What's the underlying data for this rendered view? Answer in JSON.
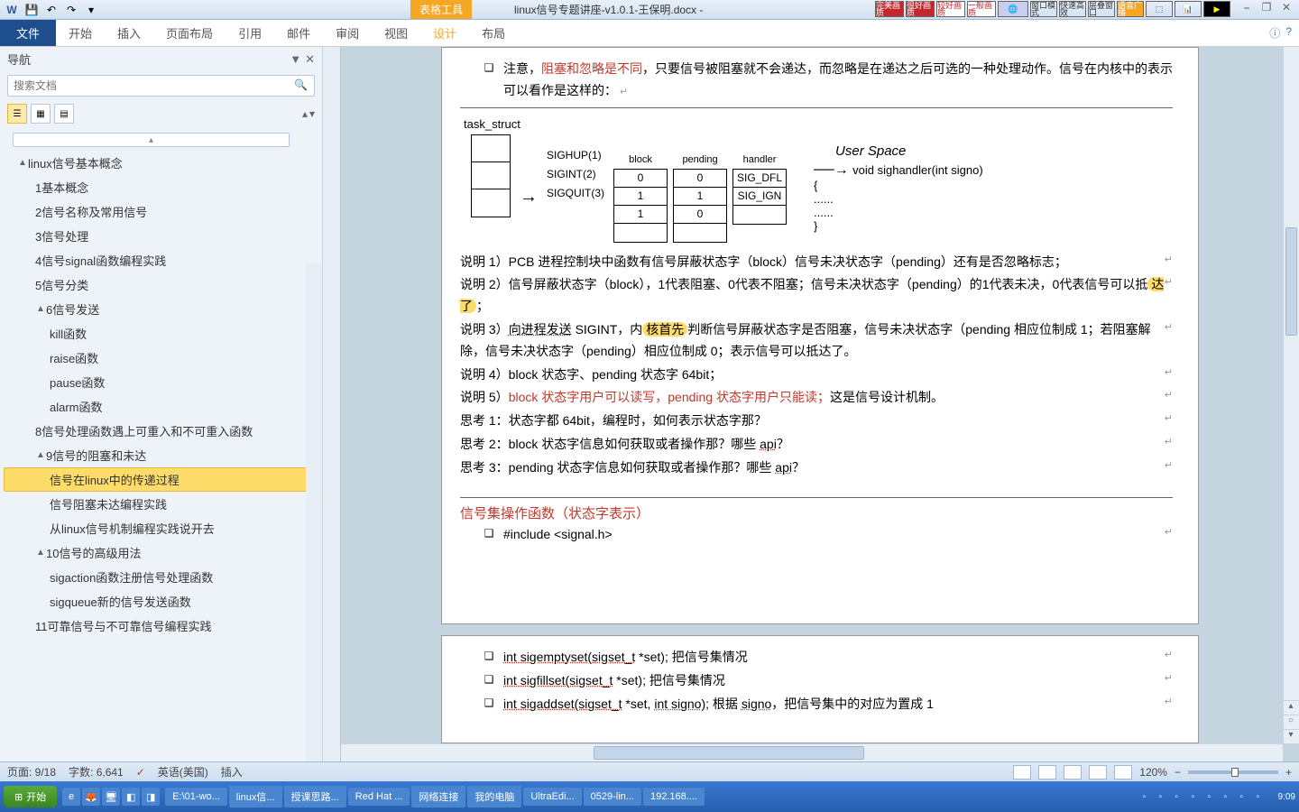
{
  "titlebar": {
    "tab_tools": "表格工具",
    "doc_title": "linux信号专题讲座-v1.0.1-王保明.docx -",
    "quality": [
      "完美画质",
      "很好画质",
      "较好画质",
      "一般画质"
    ],
    "tools": [
      "窗口模式",
      "快速高效",
      "层叠窗口",
      "语音广播"
    ]
  },
  "ribbon": {
    "file": "文件",
    "tabs": [
      "开始",
      "插入",
      "页面布局",
      "引用",
      "邮件",
      "审阅",
      "视图",
      "设计",
      "布局"
    ]
  },
  "nav": {
    "title": "导航",
    "search_placeholder": "搜索文档",
    "tree": [
      {
        "level": 1,
        "toggle": "▲",
        "text": "linux信号基本概念"
      },
      {
        "level": 2,
        "text": "1基本概念"
      },
      {
        "level": 2,
        "text": "2信号名称及常用信号"
      },
      {
        "level": 2,
        "text": "3信号处理"
      },
      {
        "level": 2,
        "text": "4信号signal函数编程实践"
      },
      {
        "level": 2,
        "text": "5信号分类"
      },
      {
        "level": 2,
        "toggle": "▲",
        "text": "6信号发送"
      },
      {
        "level": 3,
        "text": "kill函数"
      },
      {
        "level": 3,
        "text": "raise函数"
      },
      {
        "level": 3,
        "text": "pause函数"
      },
      {
        "level": 3,
        "text": "alarm函数"
      },
      {
        "level": 2,
        "text": "8信号处理函数遇上可重入和不可重入函数"
      },
      {
        "level": 2,
        "toggle": "▲",
        "text": "9信号的阻塞和未达"
      },
      {
        "level": 3,
        "text": "信号在linux中的传递过程",
        "selected": true
      },
      {
        "level": 3,
        "text": "信号阻塞未达编程实践"
      },
      {
        "level": 3,
        "text": "从linux信号机制编程实践说开去"
      },
      {
        "level": 2,
        "toggle": "▲",
        "text": "10信号的高级用法"
      },
      {
        "level": 3,
        "text": "sigaction函数注册信号处理函数"
      },
      {
        "level": 3,
        "text": "sigqueue新的信号发送函数"
      },
      {
        "level": 2,
        "text": "11可靠信号与不可靠信号编程实践"
      }
    ]
  },
  "doc": {
    "note_prefix": "注意，",
    "note_red": "阻塞和忽略是不同",
    "note_suffix": "，只要信号被阻塞就不会递达，而忽略是在递达之后可选的一种处理动作。信号在内核中的表示可以看作是这样的：",
    "diagram": {
      "title": "task_struct",
      "signals": [
        "SIGHUP(1)",
        "SIGINT(2)",
        "SIGQUIT(3)"
      ],
      "cols": [
        "block",
        "pending",
        "handler"
      ],
      "block": [
        "0",
        "1",
        "1"
      ],
      "pending": [
        "0",
        "1",
        "0"
      ],
      "handler": [
        "SIG_DFL",
        "SIG_IGN",
        ""
      ],
      "userspace_title": "User Space",
      "userspace_code": "void sighandler(int signo)",
      "brace_open": "{",
      "dots": "......",
      "brace_close": "}"
    },
    "para1_a": "说明  1）PCB  进程控制块中函数有信号屏蔽状态字（block）信号未决状态字（pending）还有是否忽略标志；",
    "para2": "说明  2）信号屏蔽状态字（block），1代表阻塞、0代表不阻塞；信号未决状态字（pending）的1代表未决，0代表信号可以抵",
    "para2_hl": "达了",
    "para2_end": "；",
    "para3_a": "说明  3）",
    "para3_b": "向进程发送",
    "para3_c": " SIGINT，内",
    "para3_hl": "核首先",
    "para3_d": "判断信号屏蔽状态字是否阻塞，信号未决状态字（pending 相应位制成 1；若阻塞解除，信号未决状态字（pending）相应位制成 0；表示信号可以抵达了。",
    "para4": "说明 4）block 状态字、pending 状态字  64bit；",
    "para5_a": "说明 5）",
    "para5_red": "block 状态字用户可以读写，pending 状态字用户只能读；",
    "para5_b": "这是信号设计机制。",
    "think1": "思考 1：状态字都 64bit，编程时，如何表示状态字那？",
    "think2_a": "思考 2：block 状态字信息如何获取或者操作那？哪些 ",
    "think2_api": "api",
    "think2_b": "？",
    "think3_a": "思考 3：pending 状态字信息如何获取或者操作那？哪些 ",
    "think3_api": "api",
    "think3_b": "？",
    "section": "信号集操作函数（状态字表示）",
    "include": "#include <signal.h>",
    "func1_a": "int ",
    "func1_b": "sigemptyset(sigset_t",
    "func1_c": " *set);  把信号集情况",
    "func2_a": "int ",
    "func2_b": "sigfillset(sigset_t",
    "func2_c": " *set);  把信号集情况",
    "func3_a": "int ",
    "func3_b": "sigaddset(sigset_t",
    "func3_c": " *set, ",
    "func3_d": "int signo",
    "func3_e": ");  根据 ",
    "func3_f": "signo",
    "func3_g": "，把信号集中的对应为置成 1"
  },
  "status": {
    "page": "页面: 9/18",
    "words": "字数: 6,641",
    "lang": "英语(美国)",
    "mode": "插入",
    "zoom": "120%"
  },
  "taskbar": {
    "start": "开始",
    "tasks": [
      "E:\\01-wo...",
      "linux信...",
      "授课思路...",
      "Red Hat ...",
      "网络连接",
      "我的电脑",
      "UltraEdi...",
      "0529-lin...",
      "192.168...."
    ],
    "time": "9:09"
  }
}
